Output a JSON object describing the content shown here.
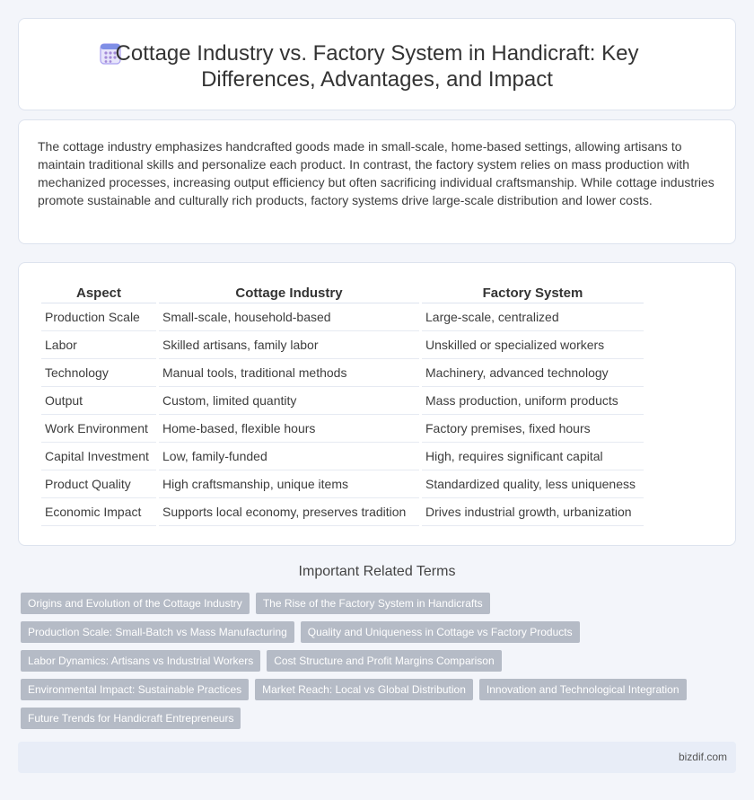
{
  "header": {
    "icon": "calendar-icon",
    "title": "Cottage Industry vs. Factory System in Handicraft: Key Differences, Advantages, and Impact"
  },
  "summary": {
    "text": "The cottage industry emphasizes handcrafted goods made in small-scale, home-based settings, allowing artisans to maintain traditional skills and personalize each product. In contrast, the factory system relies on mass production with mechanized processes, increasing output efficiency but often sacrificing individual craftsmanship. While cottage industries promote sustainable and culturally rich products, factory systems drive large-scale distribution and lower costs."
  },
  "table": {
    "headers": [
      "Aspect",
      "Cottage Industry",
      "Factory System"
    ],
    "rows": [
      [
        "Production Scale",
        "Small-scale, household-based",
        "Large-scale, centralized"
      ],
      [
        "Labor",
        "Skilled artisans, family labor",
        "Unskilled or specialized workers"
      ],
      [
        "Technology",
        "Manual tools, traditional methods",
        "Machinery, advanced technology"
      ],
      [
        "Output",
        "Custom, limited quantity",
        "Mass production, uniform products"
      ],
      [
        "Work Environment",
        "Home-based, flexible hours",
        "Factory premises, fixed hours"
      ],
      [
        "Capital Investment",
        "Low, family-funded",
        "High, requires significant capital"
      ],
      [
        "Product Quality",
        "High craftsmanship, unique items",
        "Standardized quality, less uniqueness"
      ],
      [
        "Economic Impact",
        "Supports local economy, preserves tradition",
        "Drives industrial growth, urbanization"
      ]
    ]
  },
  "related": {
    "title": "Important Related Terms",
    "tags": [
      "Origins and Evolution of the Cottage Industry",
      "The Rise of the Factory System in Handicrafts",
      "Production Scale: Small-Batch vs Mass Manufacturing",
      "Quality and Uniqueness in Cottage vs Factory Products",
      "Labor Dynamics: Artisans vs Industrial Workers",
      "Cost Structure and Profit Margins Comparison",
      "Environmental Impact: Sustainable Practices",
      "Market Reach: Local vs Global Distribution",
      "Innovation and Technological Integration",
      "Future Trends for Handicraft Entrepreneurs"
    ]
  },
  "footer": {
    "brand": "bizdif.com"
  },
  "colors": {
    "page_bg": "#f3f5fa",
    "card_bg": "#ffffff",
    "tag_bg": "#b5bbc6",
    "footer_bg": "#e8edf7",
    "icon_accent": "#8b7fe0"
  }
}
